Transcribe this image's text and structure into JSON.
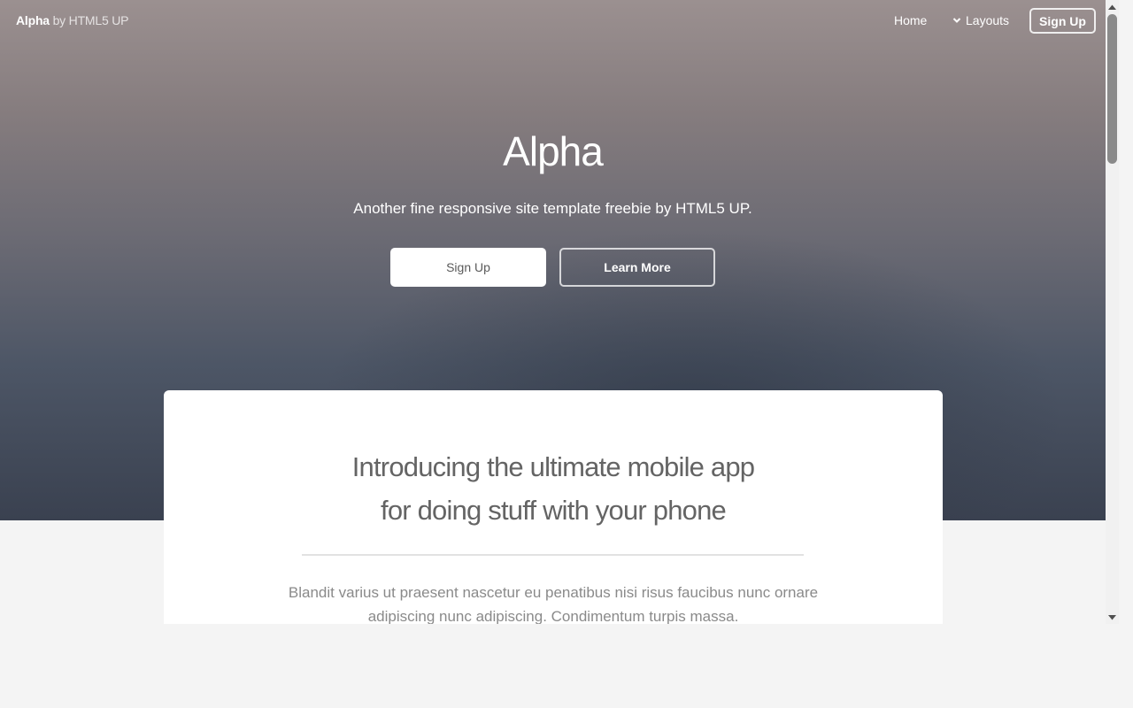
{
  "header": {
    "brand_name": "Alpha",
    "brand_suffix": "by HTML5 UP",
    "nav": {
      "home_label": "Home",
      "layouts_label": "Layouts",
      "signup_label": "Sign Up"
    }
  },
  "hero": {
    "title": "Alpha",
    "subtitle": "Another fine responsive site template freebie by HTML5 UP.",
    "primary_button": "Sign Up",
    "secondary_button": "Learn More"
  },
  "intro": {
    "heading_line1": "Introducing the ultimate mobile app",
    "heading_line2": "for doing stuff with your phone",
    "body_line1": "Blandit varius ut praesent nascetur eu penatibus nisi risus faucibus nunc ornare",
    "body_line2": "adipiscing nunc adipiscing. Condimentum turpis massa."
  },
  "icons": {
    "layouts_chevron": "chevron-down-icon",
    "scroll_up": "scroll-up-arrow-icon",
    "scroll_down": "scroll-down-arrow-icon"
  },
  "colors": {
    "page_background": "#f4f4f4",
    "card_background": "#ffffff",
    "heading_text": "#646464",
    "body_text": "#8a8a8a"
  }
}
